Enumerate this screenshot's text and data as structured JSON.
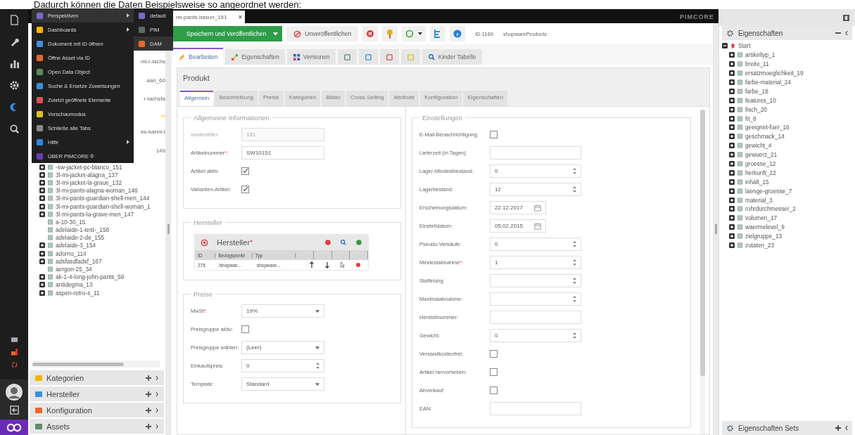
{
  "caption": "Dadurch können die Daten Beispielsweise so angeordnet werden:",
  "main_menu": {
    "items": [
      {
        "label": "Perspektiven",
        "submenu": true,
        "selected": true
      },
      {
        "label": "Dashboards",
        "submenu": true,
        "selected": false
      },
      {
        "label": "Dokument mit ID öffnen",
        "submenu": false,
        "selected": false
      },
      {
        "label": "Öffne Asset via ID",
        "submenu": false,
        "selected": false
      },
      {
        "label": "Open Data Object",
        "submenu": false,
        "selected": false
      },
      {
        "label": "Suche & Ersetze Zuweisungen",
        "submenu": false,
        "selected": false
      },
      {
        "label": "Zuletzt geöffnete Elemente",
        "submenu": false,
        "selected": false
      },
      {
        "label": "Vorschaumodus",
        "submenu": false,
        "selected": false
      },
      {
        "label": "Schließe alle Tabs",
        "submenu": false,
        "selected": false
      },
      {
        "label": "Hilfe",
        "submenu": true,
        "selected": false
      },
      {
        "label": "ÜBER PIMCORE ®",
        "submenu": false,
        "selected": false
      }
    ],
    "submenu": [
      {
        "label": "default",
        "selected": false
      },
      {
        "label": "PIM",
        "selected": false
      },
      {
        "label": "DAM",
        "selected": true
      }
    ]
  },
  "left_tree": {
    "partly_covered_rows": [
      {
        "text": "mi-r-lachs",
        "selected": false
      },
      {
        "text": "aan_60",
        "selected": false
      },
      {
        "text": "r-lachsfa",
        "selected": false
      },
      {
        "selected": true
      },
      {
        "text": "es-kanni-t",
        "selected": false
      },
      {
        "text": "149",
        "selected": false
      }
    ],
    "rows": [
      {
        "label": "-sw-jacket-pc-blanco_151",
        "kind": "node",
        "expanded": false
      },
      {
        "label": "3l-mi-jacket-alagna_137",
        "kind": "node",
        "expanded": false
      },
      {
        "label": "3l-mi-jacket-la-graue_132",
        "kind": "node",
        "expanded": false
      },
      {
        "label": "3l-mi-pants-alagna-woman_146",
        "kind": "node",
        "expanded": false
      },
      {
        "label": "3l-mi-pants-guardian-shell-men_144",
        "kind": "node",
        "expanded": false
      },
      {
        "label": "3l-mi-pants-guardian-shell-woman_1",
        "kind": "node",
        "expanded": false
      },
      {
        "label": "3l-mi-pants-la-grave-men_147",
        "kind": "node",
        "expanded": false
      },
      {
        "label": "a-10-30_15",
        "kind": "leaf"
      },
      {
        "label": "adelaide-1-test-_156",
        "kind": "leaf"
      },
      {
        "label": "adelaide-2-de_155",
        "kind": "leaf"
      },
      {
        "label": "adelaide-3_154",
        "kind": "node",
        "expanded": false
      },
      {
        "label": "adorno_114",
        "kind": "node",
        "expanded": false
      },
      {
        "label": "adsfasdfadsf_167",
        "kind": "node",
        "expanded": false
      },
      {
        "label": "aergon-25_34",
        "kind": "leaf"
      },
      {
        "label": "ak-1-4-long-john-pants_58",
        "kind": "node",
        "expanded": false
      },
      {
        "label": "antidegma_13",
        "kind": "node",
        "expanded": false
      },
      {
        "label": "aspen-retro-s_11",
        "kind": "node",
        "expanded": false
      }
    ]
  },
  "left_accordion": [
    {
      "label": "Kategorien"
    },
    {
      "label": "Hersteller"
    },
    {
      "label": "Konfiguration"
    },
    {
      "label": "Assets"
    }
  ],
  "top_tab": {
    "label": "mi-pants basun_151",
    "close": "×"
  },
  "brand": "PIMCORE",
  "toolbar": {
    "save": "Speichern und Veröffentlichen",
    "unpublish": "Unveröffentlichen",
    "id": "ID 1169",
    "class_name": "shopwareProducts"
  },
  "doc_tabs": [
    {
      "kind": "edit",
      "label": "Bearbeiten",
      "selected": true
    },
    {
      "kind": "properties",
      "label": "Eigenschaften",
      "selected": false
    },
    {
      "kind": "versions",
      "label": "Versionen",
      "selected": false
    },
    {
      "kind": "icon",
      "selected": false
    },
    {
      "kind": "icon",
      "selected": false
    },
    {
      "kind": "icon",
      "selected": false
    },
    {
      "kind": "icon",
      "selected": false
    },
    {
      "kind": "search",
      "label": "Kinder Tabelle",
      "selected": false
    }
  ],
  "panel": {
    "title": "Produkt",
    "subtabs": [
      {
        "label": "Allgemein",
        "selected": true
      },
      {
        "label": "Beschreibung",
        "selected": false
      },
      {
        "label": "Preise",
        "selected": false
      },
      {
        "label": "Kategorien",
        "selected": false
      },
      {
        "label": "Bilder",
        "selected": false
      },
      {
        "label": "Cross-Selling",
        "selected": false
      },
      {
        "label": "Attribute",
        "selected": false
      },
      {
        "label": "Konfiguration",
        "selected": false
      },
      {
        "label": "Eigenschaften",
        "selected": false
      }
    ],
    "left_column": [
      {
        "legend": "Allgemeine Informationen",
        "fields": [
          {
            "kind": "text",
            "label": "swIdentifier:",
            "value": "151",
            "disabled": true
          },
          {
            "kind": "text",
            "label": "Artikelnummer",
            "mark": "*:",
            "value": "SW10151",
            "disabled": false
          },
          {
            "kind": "checkbox",
            "label": "Artikel aktiv:",
            "checked": true,
            "disabled": false
          },
          {
            "kind": "checkbox",
            "label": "Varianten-Artikel:",
            "checked": true,
            "disabled": false
          }
        ]
      },
      {
        "legend": "Hersteller",
        "grid": {
          "title": "Hersteller",
          "mark": "*",
          "columns": [
            "ID",
            "Bezugspunkt",
            "Typ"
          ],
          "rows": [
            {
              "cells": [
                "275",
                "/shopwar...",
                "shopware..."
              ]
            }
          ]
        }
      },
      {
        "legend": "Preise",
        "fields": [
          {
            "kind": "select",
            "label": "MwSt",
            "mark": "*:",
            "value": "19%"
          },
          {
            "kind": "checkbox",
            "label": "Preisgruppe aktiv:",
            "checked": false
          },
          {
            "kind": "select",
            "label": "Preisgruppe wählen:",
            "value": "(Leer)"
          },
          {
            "kind": "number",
            "label": "Einkaufspreis:",
            "value": "0"
          },
          {
            "kind": "select",
            "label": "Template:",
            "value": "Standard"
          }
        ]
      }
    ],
    "right_column": [
      {
        "legend": "Einstellungen",
        "fields": [
          {
            "kind": "checkbox",
            "label": "E-Mail-Benachrichtigung:",
            "checked": false
          },
          {
            "kind": "text",
            "label": "Lieferzeit (in Tagen):"
          },
          {
            "kind": "number",
            "label": "Lager-Mindestbestand:",
            "value": "0"
          },
          {
            "kind": "number",
            "label": "Lagerbestand:",
            "value": "12"
          },
          {
            "kind": "date",
            "label": "Erscheinungsdatum:",
            "value": "22.12.2017"
          },
          {
            "kind": "date",
            "label": "Einstelldatum:",
            "value": "05.02.2015"
          },
          {
            "kind": "number",
            "label": "Pseudo-Verkäufe:",
            "value": "0"
          },
          {
            "kind": "number",
            "label": "Mindestabnahme",
            "mark": "*:",
            "value": "1"
          },
          {
            "kind": "number",
            "label": "Staffelung:"
          },
          {
            "kind": "number",
            "label": "Maximalabnahme:"
          },
          {
            "kind": "text",
            "label": "Herstellnummer:"
          },
          {
            "kind": "number",
            "label": "Gewicht:",
            "value": "0"
          },
          {
            "kind": "checkbox",
            "label": "Versandkostenfrei:",
            "checked": false
          },
          {
            "kind": "checkbox",
            "label": "Artikel hervorheben:",
            "checked": false
          },
          {
            "kind": "checkbox",
            "label": "Abverkauf:",
            "checked": false
          },
          {
            "kind": "text",
            "label": "EAN:"
          }
        ]
      }
    ]
  },
  "right_panel": {
    "title": "Eigenschaften",
    "root": {
      "label": "Start",
      "expanded": true,
      "children": [
        {
          "label": "artikeltyp_1",
          "expanded": false
        },
        {
          "label": "breite_11",
          "expanded": false
        },
        {
          "label": "ersatzmoeglichkeit_19",
          "expanded": false
        },
        {
          "label": "farbe-material_24",
          "expanded": false
        },
        {
          "label": "farbe_18",
          "expanded": false
        },
        {
          "label": "features_10",
          "expanded": false
        },
        {
          "label": "fisch_20",
          "expanded": false
        },
        {
          "label": "fit_8",
          "expanded": false
        },
        {
          "label": "geeignet-fuer_16",
          "expanded": false
        },
        {
          "label": "geschmack_14",
          "expanded": false
        },
        {
          "label": "gewicht_4",
          "expanded": false
        },
        {
          "label": "gewuerz_21",
          "expanded": false
        },
        {
          "label": "groesse_12",
          "expanded": false
        },
        {
          "label": "herkunft_22",
          "expanded": false
        },
        {
          "label": "inhalt_15",
          "expanded": false
        },
        {
          "label": "laenge-groesse_7",
          "expanded": false
        },
        {
          "label": "material_3",
          "expanded": false
        },
        {
          "label": "rohrdurchmesser_2",
          "expanded": false
        },
        {
          "label": "volumen_17",
          "expanded": false
        },
        {
          "label": "waermelevel_9",
          "expanded": false
        },
        {
          "label": "zielgruppe_13",
          "expanded": false
        },
        {
          "label": "zutaten_23",
          "expanded": false
        }
      ]
    },
    "footer_title": "Eigenschaften Sets"
  }
}
